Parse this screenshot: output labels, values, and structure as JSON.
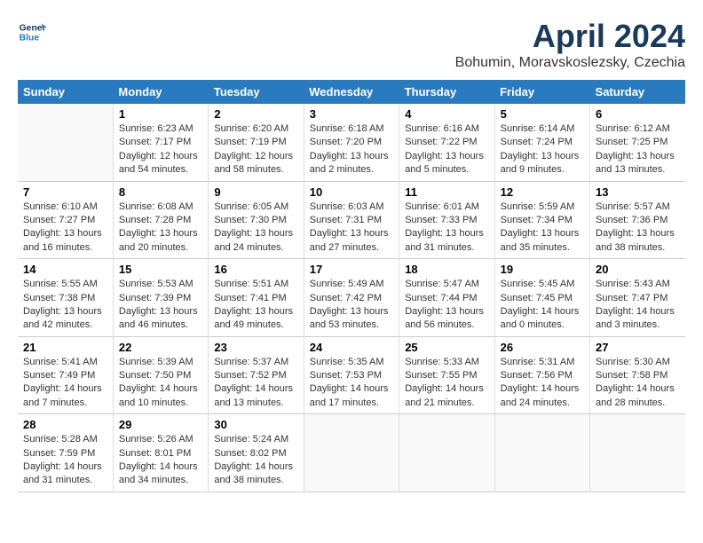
{
  "header": {
    "logo_line1": "General",
    "logo_line2": "Blue",
    "month_title": "April 2024",
    "subtitle": "Bohumin, Moravskoslezsky, Czechia"
  },
  "days_of_week": [
    "Sunday",
    "Monday",
    "Tuesday",
    "Wednesday",
    "Thursday",
    "Friday",
    "Saturday"
  ],
  "weeks": [
    [
      {
        "day": "",
        "info": ""
      },
      {
        "day": "1",
        "info": "Sunrise: 6:23 AM\nSunset: 7:17 PM\nDaylight: 12 hours\nand 54 minutes."
      },
      {
        "day": "2",
        "info": "Sunrise: 6:20 AM\nSunset: 7:19 PM\nDaylight: 12 hours\nand 58 minutes."
      },
      {
        "day": "3",
        "info": "Sunrise: 6:18 AM\nSunset: 7:20 PM\nDaylight: 13 hours\nand 2 minutes."
      },
      {
        "day": "4",
        "info": "Sunrise: 6:16 AM\nSunset: 7:22 PM\nDaylight: 13 hours\nand 5 minutes."
      },
      {
        "day": "5",
        "info": "Sunrise: 6:14 AM\nSunset: 7:24 PM\nDaylight: 13 hours\nand 9 minutes."
      },
      {
        "day": "6",
        "info": "Sunrise: 6:12 AM\nSunset: 7:25 PM\nDaylight: 13 hours\nand 13 minutes."
      }
    ],
    [
      {
        "day": "7",
        "info": "Sunrise: 6:10 AM\nSunset: 7:27 PM\nDaylight: 13 hours\nand 16 minutes."
      },
      {
        "day": "8",
        "info": "Sunrise: 6:08 AM\nSunset: 7:28 PM\nDaylight: 13 hours\nand 20 minutes."
      },
      {
        "day": "9",
        "info": "Sunrise: 6:05 AM\nSunset: 7:30 PM\nDaylight: 13 hours\nand 24 minutes."
      },
      {
        "day": "10",
        "info": "Sunrise: 6:03 AM\nSunset: 7:31 PM\nDaylight: 13 hours\nand 27 minutes."
      },
      {
        "day": "11",
        "info": "Sunrise: 6:01 AM\nSunset: 7:33 PM\nDaylight: 13 hours\nand 31 minutes."
      },
      {
        "day": "12",
        "info": "Sunrise: 5:59 AM\nSunset: 7:34 PM\nDaylight: 13 hours\nand 35 minutes."
      },
      {
        "day": "13",
        "info": "Sunrise: 5:57 AM\nSunset: 7:36 PM\nDaylight: 13 hours\nand 38 minutes."
      }
    ],
    [
      {
        "day": "14",
        "info": "Sunrise: 5:55 AM\nSunset: 7:38 PM\nDaylight: 13 hours\nand 42 minutes."
      },
      {
        "day": "15",
        "info": "Sunrise: 5:53 AM\nSunset: 7:39 PM\nDaylight: 13 hours\nand 46 minutes."
      },
      {
        "day": "16",
        "info": "Sunrise: 5:51 AM\nSunset: 7:41 PM\nDaylight: 13 hours\nand 49 minutes."
      },
      {
        "day": "17",
        "info": "Sunrise: 5:49 AM\nSunset: 7:42 PM\nDaylight: 13 hours\nand 53 minutes."
      },
      {
        "day": "18",
        "info": "Sunrise: 5:47 AM\nSunset: 7:44 PM\nDaylight: 13 hours\nand 56 minutes."
      },
      {
        "day": "19",
        "info": "Sunrise: 5:45 AM\nSunset: 7:45 PM\nDaylight: 14 hours\nand 0 minutes."
      },
      {
        "day": "20",
        "info": "Sunrise: 5:43 AM\nSunset: 7:47 PM\nDaylight: 14 hours\nand 3 minutes."
      }
    ],
    [
      {
        "day": "21",
        "info": "Sunrise: 5:41 AM\nSunset: 7:49 PM\nDaylight: 14 hours\nand 7 minutes."
      },
      {
        "day": "22",
        "info": "Sunrise: 5:39 AM\nSunset: 7:50 PM\nDaylight: 14 hours\nand 10 minutes."
      },
      {
        "day": "23",
        "info": "Sunrise: 5:37 AM\nSunset: 7:52 PM\nDaylight: 14 hours\nand 13 minutes."
      },
      {
        "day": "24",
        "info": "Sunrise: 5:35 AM\nSunset: 7:53 PM\nDaylight: 14 hours\nand 17 minutes."
      },
      {
        "day": "25",
        "info": "Sunrise: 5:33 AM\nSunset: 7:55 PM\nDaylight: 14 hours\nand 21 minutes."
      },
      {
        "day": "26",
        "info": "Sunrise: 5:31 AM\nSunset: 7:56 PM\nDaylight: 14 hours\nand 24 minutes."
      },
      {
        "day": "27",
        "info": "Sunrise: 5:30 AM\nSunset: 7:58 PM\nDaylight: 14 hours\nand 28 minutes."
      }
    ],
    [
      {
        "day": "28",
        "info": "Sunrise: 5:28 AM\nSunset: 7:59 PM\nDaylight: 14 hours\nand 31 minutes."
      },
      {
        "day": "29",
        "info": "Sunrise: 5:26 AM\nSunset: 8:01 PM\nDaylight: 14 hours\nand 34 minutes."
      },
      {
        "day": "30",
        "info": "Sunrise: 5:24 AM\nSunset: 8:02 PM\nDaylight: 14 hours\nand 38 minutes."
      },
      {
        "day": "",
        "info": ""
      },
      {
        "day": "",
        "info": ""
      },
      {
        "day": "",
        "info": ""
      },
      {
        "day": "",
        "info": ""
      }
    ]
  ]
}
